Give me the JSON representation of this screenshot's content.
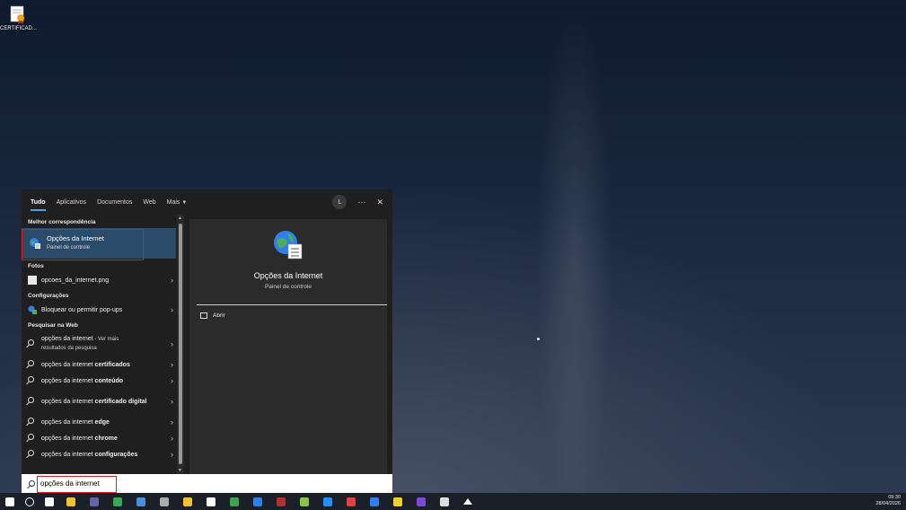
{
  "desktop": {
    "icon_label": "CERTIFICAD..."
  },
  "tabs": [
    "Tudo",
    "Aplicativos",
    "Documentos",
    "Web",
    "Mais"
  ],
  "header": {
    "avatar_letter": "L",
    "more_symbol": "···",
    "close_symbol": "✕"
  },
  "sections": {
    "best": "Melhor correspondência",
    "photos": "Fotos",
    "settings": "Configurações",
    "web": "Pesquisar na Web"
  },
  "best_match": {
    "title": "Opções da Internet",
    "subtitle": "Painel de controle"
  },
  "photo_item": "opcoes_da_internet.png",
  "settings_item": "Bloquear ou permitir pop-ups",
  "web_first": {
    "text": "opções da internet",
    "suffix": " - Ver mais",
    "sub": "resultados da pesquisa"
  },
  "web_items": [
    {
      "prefix": "opções da internet ",
      "bold": "certificados"
    },
    {
      "prefix": "opções da internet ",
      "bold": "conteúdo"
    },
    {
      "prefix": "opções da internet ",
      "bold": "certificado digital"
    },
    {
      "prefix": "opções da internet ",
      "bold": "edge"
    },
    {
      "prefix": "opções da internet ",
      "bold": "chrome"
    },
    {
      "prefix": "opções da internet ",
      "bold": "configurações"
    }
  ],
  "detail": {
    "title": "Opções da Internet",
    "subtitle": "Painel de controle",
    "action": "Abrir"
  },
  "search": {
    "value": "opções da internet"
  },
  "taskbar": {
    "icons": [
      "windows-start-icon",
      "search-icon",
      "task-view-icon",
      "file-explorer-icon",
      "teams-icon",
      "chrome-icon",
      "app-icon",
      "remote-icon",
      "sticky-icon",
      "github-icon",
      "app-icon-2",
      "app-icon-3",
      "app-icon-4",
      "notes-icon",
      "edge-icon",
      "app-icon-5",
      "app-icon-6",
      "app-icon-7",
      "app-icon-8",
      "app-icon-9",
      "tray-arrow-icon"
    ],
    "colors": [
      "#ffffff",
      "#ffffff",
      "#ffffff",
      "#f2c230",
      "#6264a7",
      "#34a853",
      "#4a90d9",
      "#aaaaaa",
      "#f2c230",
      "#ffffff",
      "#3fa34d",
      "#2f80ed",
      "#b03030",
      "#8bc34a",
      "#1e90ff",
      "#e04040",
      "#2f80ed",
      "#f2d12e",
      "#7b4bd8",
      "#dddddd",
      "#ffffff"
    ],
    "time": "09:30",
    "date": "28/04/2026"
  }
}
